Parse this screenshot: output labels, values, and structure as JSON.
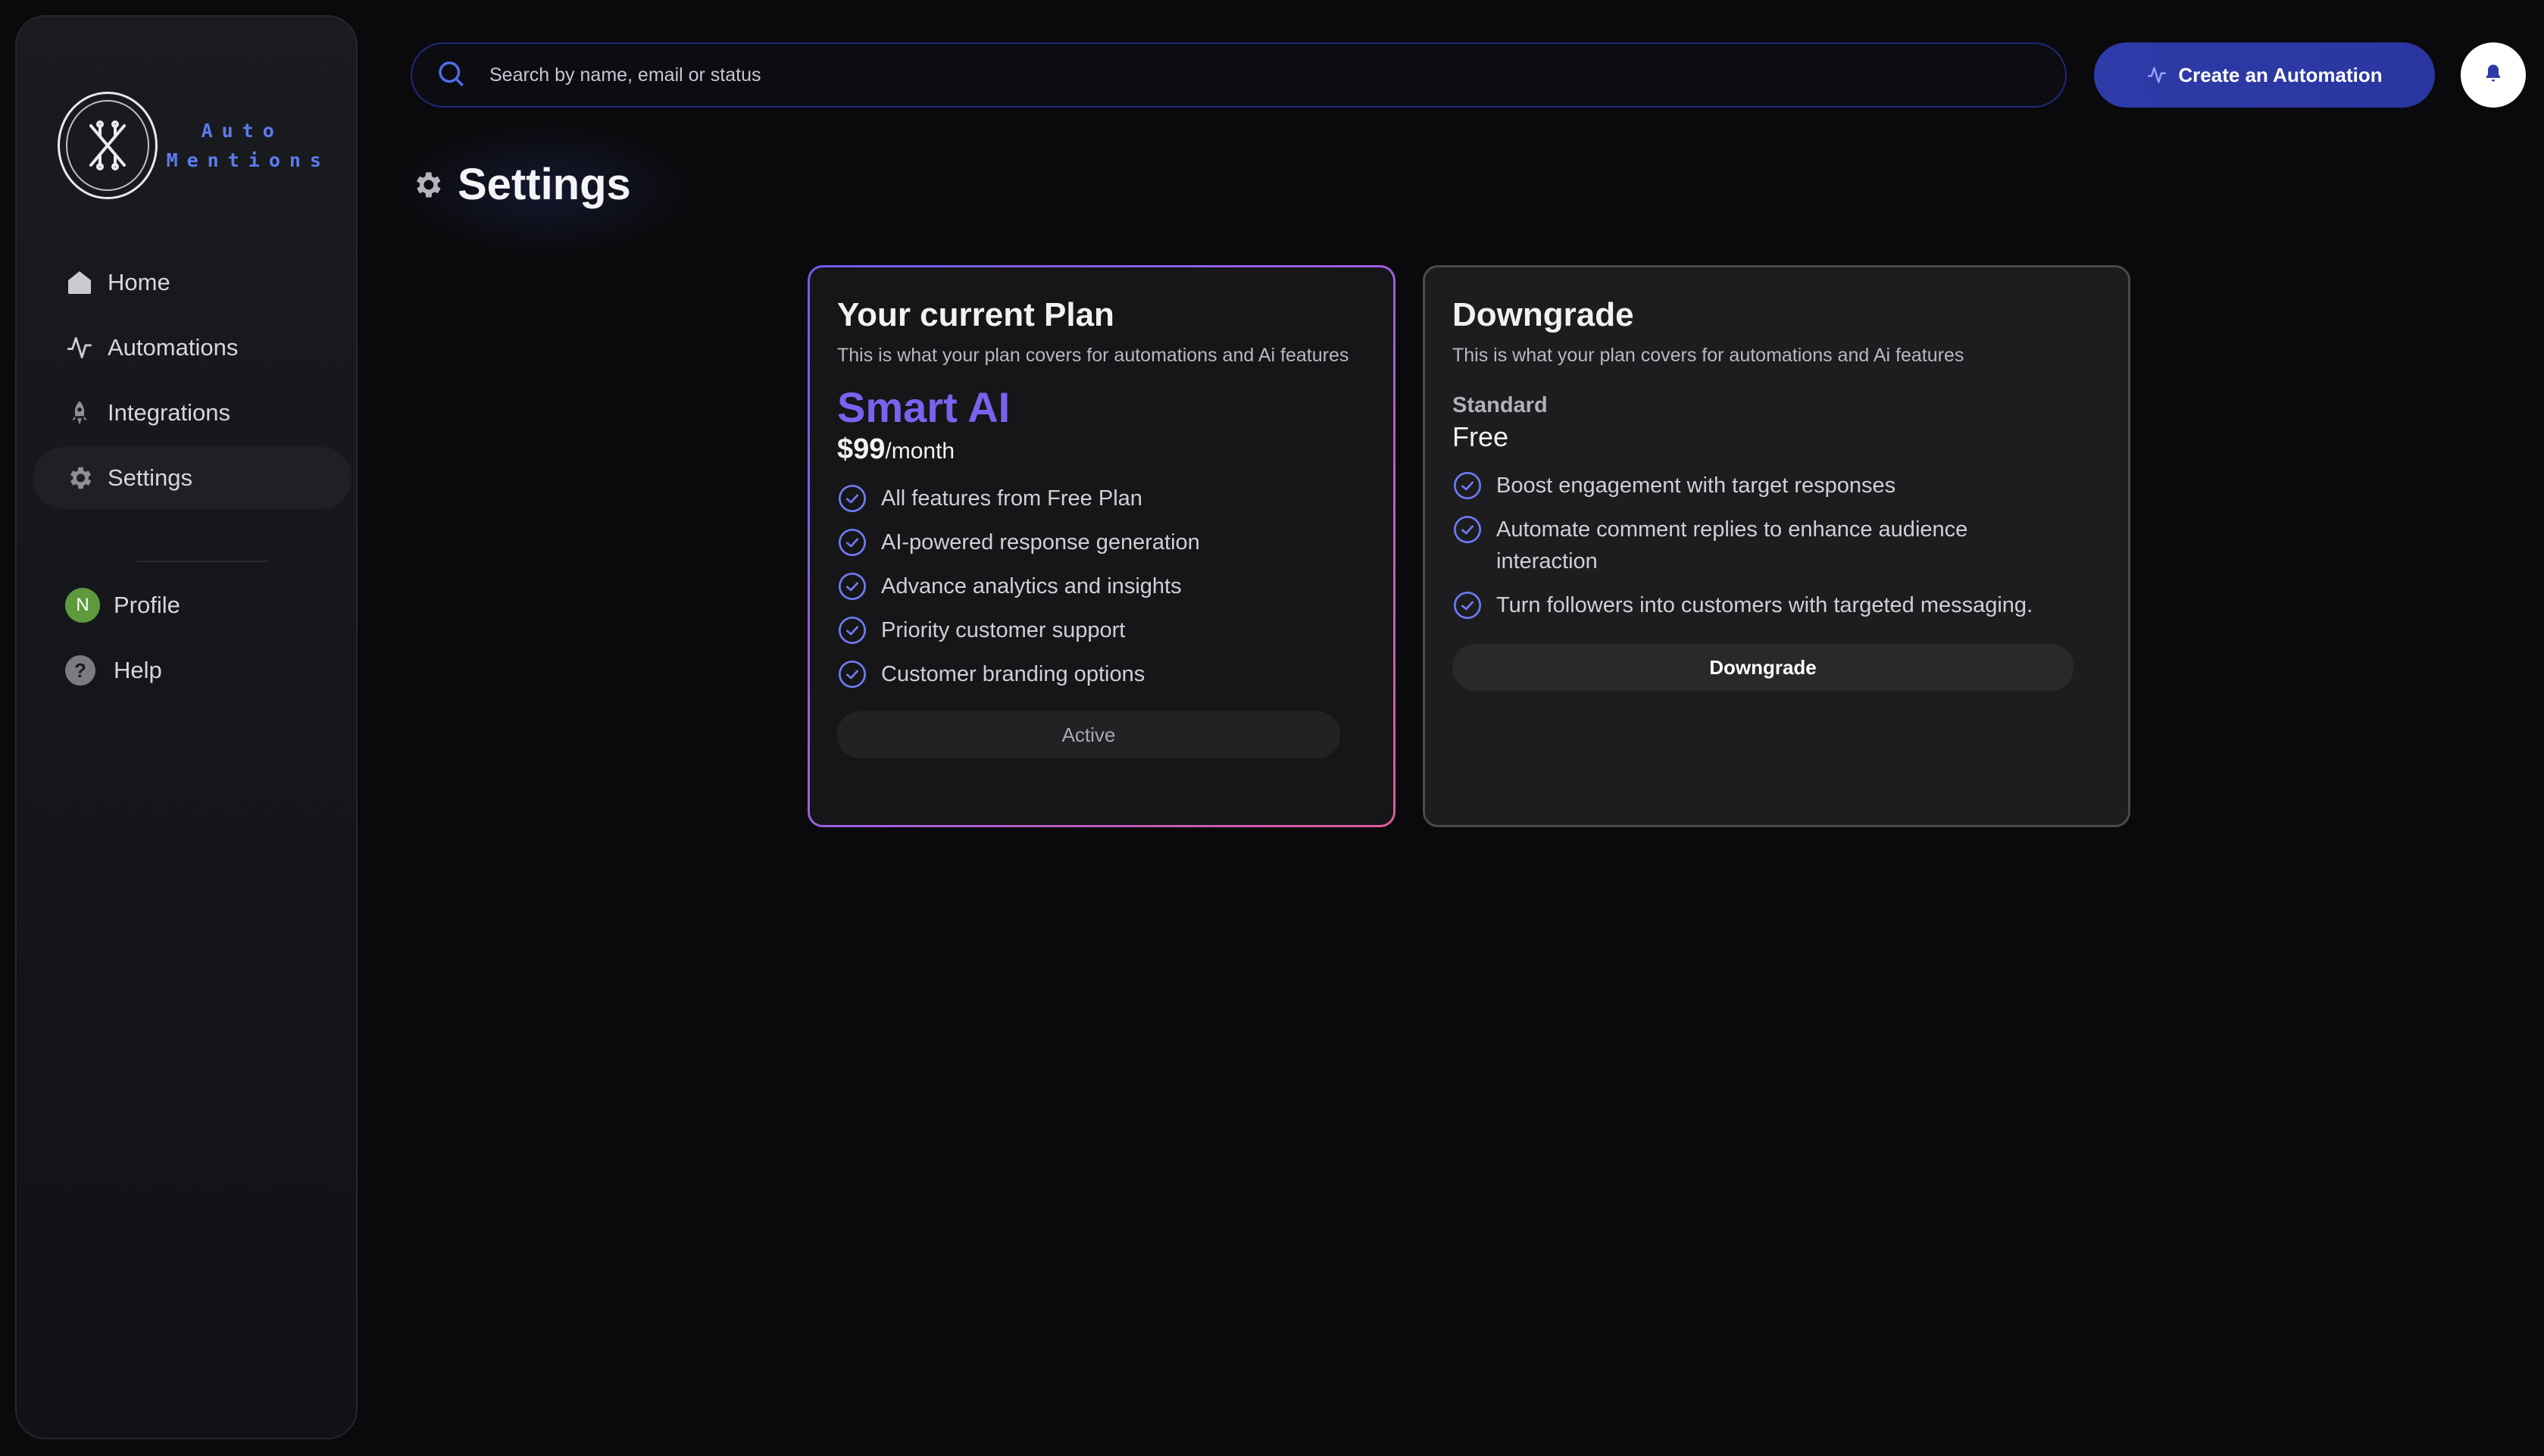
{
  "brand": {
    "line1": "Auto",
    "line2": "Mentions",
    "accent": "#5b7cf0"
  },
  "sidebar": {
    "items": [
      {
        "label": "Home",
        "icon": "home-icon"
      },
      {
        "label": "Automations",
        "icon": "activity-icon"
      },
      {
        "label": "Integrations",
        "icon": "rocket-icon"
      },
      {
        "label": "Settings",
        "icon": "gear-icon",
        "active": true
      }
    ],
    "secondary": [
      {
        "label": "Profile",
        "avatar_letter": "N",
        "avatar_color": "#5e9a3c"
      },
      {
        "label": "Help",
        "icon": "help-icon"
      }
    ]
  },
  "header": {
    "search_placeholder": "Search by name, email or status",
    "create_label": "Create an Automation",
    "create_color": "#2e3ba8"
  },
  "page": {
    "title": "Settings"
  },
  "current_plan": {
    "title": "Your current Plan",
    "subtitle": "This is what your plan covers for automations and Ai features",
    "plan_name": "Smart AI",
    "price": "$99",
    "period": "/month",
    "features": [
      "All features from Free Plan",
      "AI-powered response generation",
      "Advance analytics and insights",
      "Priority customer support",
      "Customer branding options"
    ],
    "button_label": "Active",
    "accent": "#7b62ee"
  },
  "downgrade_plan": {
    "title": "Downgrade",
    "subtitle": "This is what your plan covers for automations and Ai features",
    "tier": "Standard",
    "price": "Free",
    "features": [
      "Boost engagement with target responses",
      "Automate comment replies to enhance audience interaction",
      "Turn followers into customers with targeted messaging."
    ],
    "button_label": "Downgrade"
  }
}
